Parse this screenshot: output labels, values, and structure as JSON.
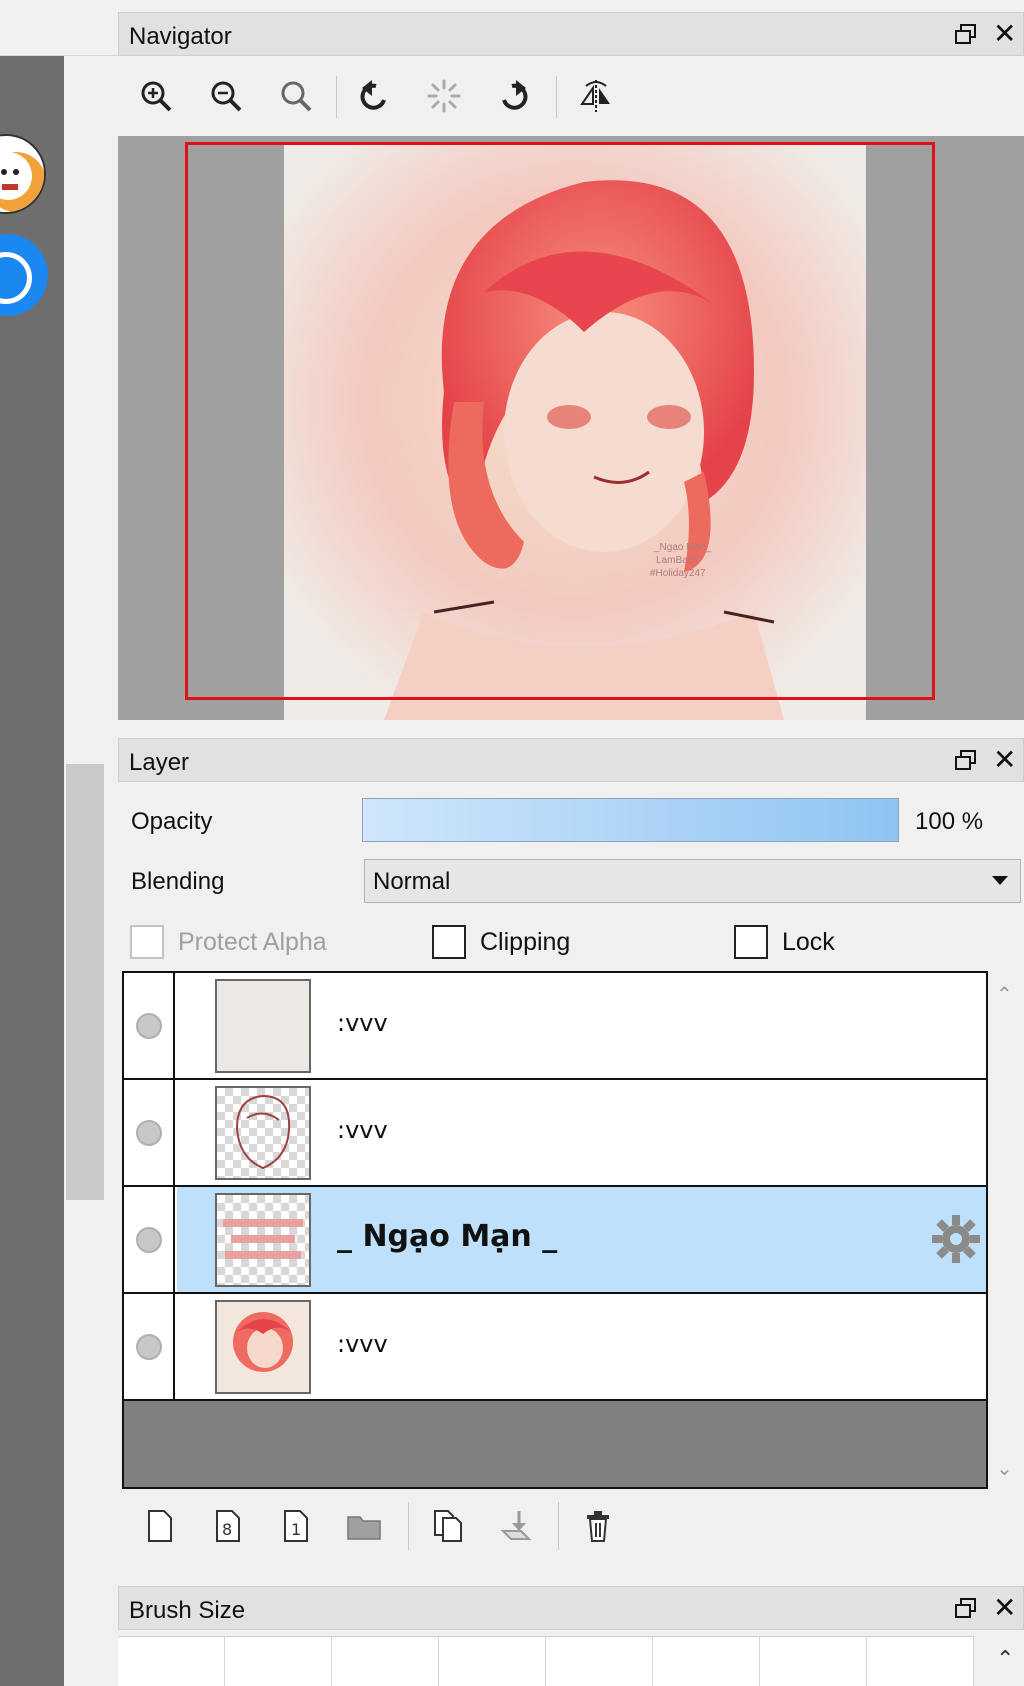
{
  "navigator": {
    "title": "Navigator",
    "toolbar_icons": [
      "zoom-in-icon",
      "zoom-out-icon",
      "zoom-reset-icon",
      "rotate-left-icon",
      "rotate-reset-icon",
      "rotate-right-icon",
      "flip-horizontal-icon"
    ],
    "signature_text": [
      "_Ngạo Mạn_",
      "LamBach",
      "#Holiday247"
    ]
  },
  "layer": {
    "title": "Layer",
    "opacity_label": "Opacity",
    "opacity_value": "100 %",
    "opacity_fraction": 1.0,
    "blending_label": "Blending",
    "blending_value": "Normal",
    "protect_alpha_label": "Protect Alpha",
    "clipping_label": "Clipping",
    "lock_label": "Lock",
    "rows": [
      {
        "name": ":vvv",
        "selected": false
      },
      {
        "name": ":vvv",
        "selected": false
      },
      {
        "name": "_ Ngạo Mạn _",
        "selected": true
      },
      {
        "name": ":vvv",
        "selected": false
      }
    ],
    "bottom_toolbar_icons": [
      "new-layer-icon",
      "new-8bit-layer-icon",
      "new-1bit-layer-icon",
      "new-folder-icon",
      "duplicate-layer-icon",
      "merge-down-icon",
      "delete-layer-icon"
    ]
  },
  "brush_size": {
    "title": "Brush Size"
  },
  "colors": {
    "accent_blue": "#1b87f0",
    "selected_row": "#bfe0fb",
    "nav_frame": "#e0101a"
  }
}
